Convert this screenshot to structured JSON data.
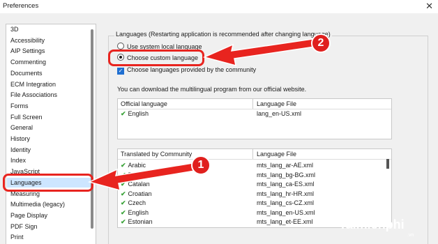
{
  "window": {
    "title": "Preferences",
    "close_glyph": "✕"
  },
  "sidebar": {
    "items": [
      {
        "label": "3D"
      },
      {
        "label": "Accessibility"
      },
      {
        "label": "AIP Settings"
      },
      {
        "label": "Commenting"
      },
      {
        "label": "Documents"
      },
      {
        "label": "ECM Integration"
      },
      {
        "label": "File Associations"
      },
      {
        "label": "Forms"
      },
      {
        "label": "Full Screen"
      },
      {
        "label": "General"
      },
      {
        "label": "History"
      },
      {
        "label": "Identity"
      },
      {
        "label": "Index"
      },
      {
        "label": "JavaScript"
      },
      {
        "label": "Languages",
        "selected": true
      },
      {
        "label": "Measuring"
      },
      {
        "label": "Multimedia (legacy)"
      },
      {
        "label": "Page Display"
      },
      {
        "label": "PDF Sign"
      },
      {
        "label": "Print"
      }
    ]
  },
  "languages": {
    "group_title": "Languages (Restarting application is recommended after changing language)",
    "option_system": "Use system local language",
    "option_custom": "Choose custom language",
    "option_community": "Choose languages provided by the community",
    "info": "You can download the multilingual program from our official website."
  },
  "official_table": {
    "headers": [
      "Official language",
      "Language File"
    ],
    "rows": [
      {
        "language": "English",
        "file": "lang_en-US.xml"
      }
    ]
  },
  "community_table": {
    "headers": [
      "Translated by Community",
      "Language File"
    ],
    "rows": [
      {
        "language": "Arabic",
        "file": "mts_lang_ar-AE.xml"
      },
      {
        "language": "Bulgarian",
        "file": "mts_lang_bg-BG.xml"
      },
      {
        "language": "Catalan",
        "file": "mts_lang_ca-ES.xml"
      },
      {
        "language": "Croatian",
        "file": "mts_lang_hr-HR.xml"
      },
      {
        "language": "Czech",
        "file": "mts_lang_cs-CZ.xml"
      },
      {
        "language": "English",
        "file": "mts_lang_en-US.xml"
      },
      {
        "language": "Estonian",
        "file": "mts_lang_et-EE.xml"
      }
    ]
  },
  "annotations": {
    "badge_1": "1",
    "badge_2": "2",
    "color": "#e8241f"
  },
  "watermark": {
    "text": "Taimienphi",
    "suffix": ".vn"
  }
}
